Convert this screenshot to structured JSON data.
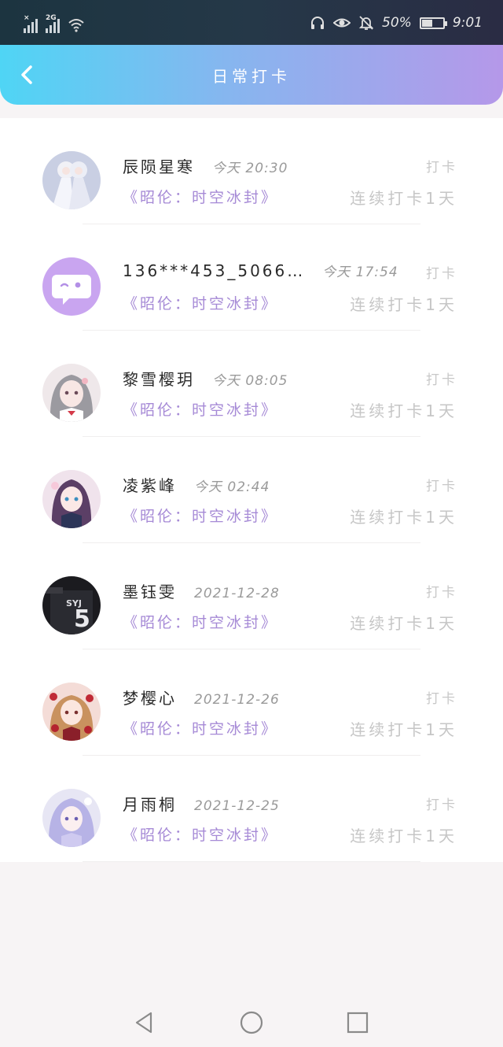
{
  "status_bar": {
    "sim1_tag": "×",
    "sim2_tag": "2G",
    "battery_text": "50%",
    "battery_level": 0.5,
    "time": "9:01"
  },
  "header": {
    "title": "日常打卡",
    "back_icon": "chevron-left-icon"
  },
  "list": {
    "rows": [
      {
        "name": "辰陨星寒",
        "time": "今天 20:30",
        "book": "《昭伦：时空冰封》",
        "action": "打卡",
        "streak": "连续打卡1天",
        "avatar": "anime-girl-white-dress"
      },
      {
        "name": "136***453_5066…",
        "time": "今天 17:54",
        "book": "《昭伦：时空冰封》",
        "action": "打卡",
        "streak": "连续打卡1天",
        "avatar": "default-chat-bubble"
      },
      {
        "name": "黎雪樱玥",
        "time": "今天 08:05",
        "book": "《昭伦：时空冰封》",
        "action": "打卡",
        "streak": "连续打卡1天",
        "avatar": "anime-girl-grey-hair"
      },
      {
        "name": "凌紫峰",
        "time": "今天 02:44",
        "book": "《昭伦：时空冰封》",
        "action": "打卡",
        "streak": "连续打卡1天",
        "avatar": "anime-girl-purple-hair"
      },
      {
        "name": "墨钰雯",
        "time": "2021-12-28",
        "book": "《昭伦：时空冰封》",
        "action": "打卡",
        "streak": "连续打卡1天",
        "avatar": "jersey-number-5"
      },
      {
        "name": "梦樱心",
        "time": "2021-12-26",
        "book": "《昭伦：时空冰封》",
        "action": "打卡",
        "streak": "连续打卡1天",
        "avatar": "anime-girl-red-flowers"
      },
      {
        "name": "月雨桐",
        "time": "2021-12-25",
        "book": "《昭伦：时空冰封》",
        "action": "打卡",
        "streak": "连续打卡1天",
        "avatar": "anime-girl-lavender"
      }
    ]
  },
  "nav_bar": {
    "back_icon": "triangle-back-icon",
    "home_icon": "circle-home-icon",
    "recents_icon": "square-recents-icon"
  },
  "colors": {
    "header_gradient": [
      "#4fd5f5",
      "#86b6ef",
      "#b598e9"
    ],
    "book_title": "#a68ad6",
    "muted": "#c6c6c6"
  }
}
